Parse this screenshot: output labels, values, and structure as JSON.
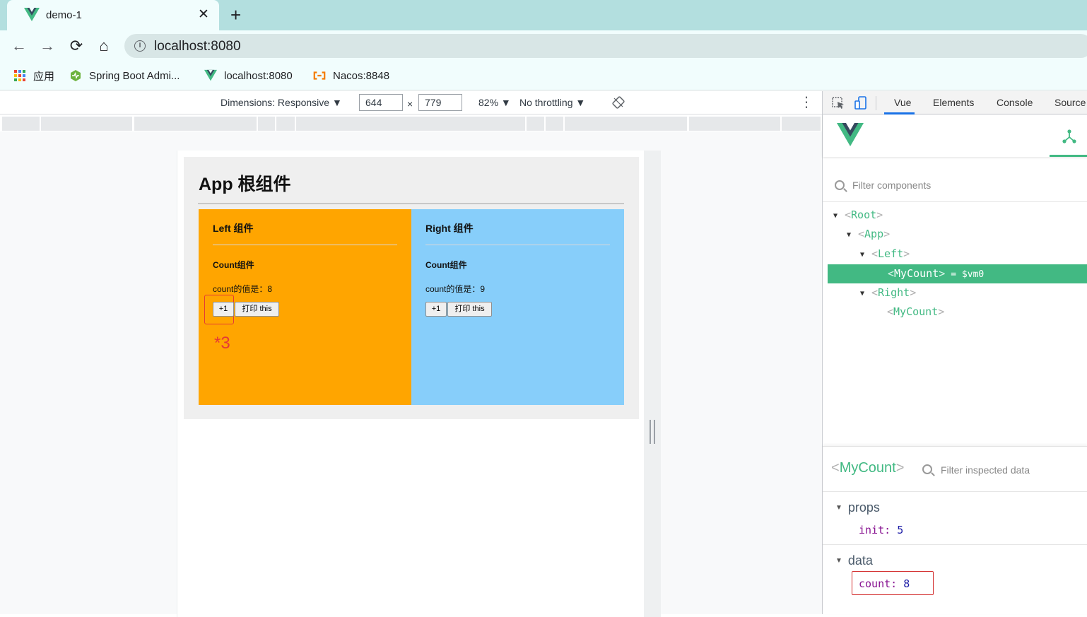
{
  "browser": {
    "tab_title": "demo-1",
    "close_glyph": "✕",
    "new_tab_glyph": "+",
    "url": "localhost:8080",
    "nav": {
      "back": "←",
      "forward": "→",
      "reload": "⟳",
      "home": "⌂"
    },
    "bookmarks": [
      {
        "label": "应用",
        "icon": "apps-grid-icon"
      },
      {
        "label": "Spring Boot Admi...",
        "icon": "spring-boot-admin-icon"
      },
      {
        "label": "localhost:8080",
        "icon": "vue-logo-icon"
      },
      {
        "label": "Nacos:8848",
        "icon": "nacos-icon"
      }
    ]
  },
  "emulation": {
    "dimensions": "Dimensions: Responsive ▼",
    "width": "644",
    "times": "×",
    "height": "779",
    "zoom": "82% ▼",
    "throttling": "No throttling ▼",
    "more": "⋮"
  },
  "app": {
    "title": "App 根组件",
    "left": {
      "title": "Left 组件",
      "count_title": "Count组件",
      "count_value": "count的值是：8",
      "plus_label": "+1",
      "print_label": "打印 this",
      "annotation": "*3"
    },
    "right": {
      "title": "Right 组件",
      "count_title": "Count组件",
      "count_value": "count的值是：9",
      "plus_label": "+1",
      "print_label": "打印 this"
    }
  },
  "devtools": {
    "tabs": [
      "Vue",
      "Elements",
      "Console",
      "Source"
    ],
    "active_tab": "Vue",
    "filter_components": "Filter components",
    "tree": {
      "root": "Root",
      "app": "App",
      "left": "Left",
      "mycount_selected": "MyCount",
      "vm_tag": "= $vm0",
      "right": "Right",
      "mycount": "MyCount"
    },
    "inspector": {
      "component": "MyCount",
      "filter_placeholder": "Filter inspected data",
      "props_label": "props",
      "props": {
        "key": "init:",
        "value": "5"
      },
      "data_label": "data",
      "data": {
        "key": "count:",
        "value": "8"
      }
    }
  },
  "colors": {
    "vue_green": "#42b983",
    "left_panel": "#ffa500",
    "right_panel": "#87cefa",
    "annotation_red": "#e53935"
  }
}
